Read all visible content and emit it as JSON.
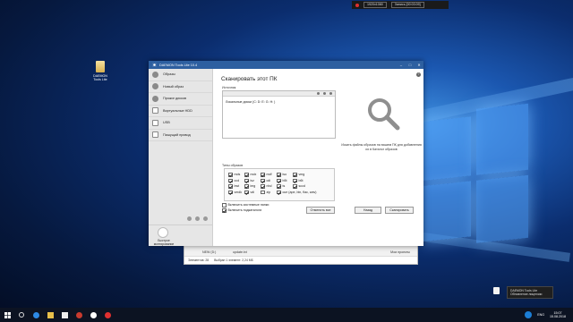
{
  "recorder": {
    "resolution": "1920x1080",
    "status": "Запись [00:03:09]"
  },
  "desktop_icon": {
    "label": "DAEMON Tools Lite"
  },
  "window": {
    "title": "DAEMON Tools Lite 10.4"
  },
  "sidebar": {
    "items": [
      {
        "label": "Образы",
        "icon": "disc-icon"
      },
      {
        "label": "Новый образ",
        "icon": "plus-disc-icon"
      },
      {
        "label": "Прожиг дисков",
        "icon": "burn-icon"
      },
      {
        "label": "Виртуальные HDD",
        "icon": "hdd-icon"
      },
      {
        "label": "USB",
        "icon": "usb-icon"
      },
      {
        "label": "Пишущий привод",
        "icon": "drive-icon"
      }
    ],
    "quick_mount_label": "Быстрое монтирование"
  },
  "main": {
    "title": "Сканировать этот ПК",
    "source_label": "Источник",
    "source_item": "Локальные диски (C: D: E: G: H: )",
    "hint": "Искать файлы образов на вашем ПК для добавления их в Каталог образов",
    "include_system_folders": "Включить системные папки",
    "include_subfolders": "Включить подкаталоги",
    "image_types_label": "Типы образов",
    "image_types": [
      {
        "label": "mds",
        "checked": true
      },
      {
        "label": "mdx",
        "checked": true
      },
      {
        "label": "mdf",
        "checked": true
      },
      {
        "label": "iso",
        "checked": true
      },
      {
        "label": "vmg",
        "checked": true
      },
      {
        "label": "ccd",
        "checked": true
      },
      {
        "label": "isz",
        "checked": true
      },
      {
        "label": "cdi",
        "checked": true
      },
      {
        "label": "b5t",
        "checked": true
      },
      {
        "label": "b6t",
        "checked": true
      },
      {
        "label": "bwt",
        "checked": true
      },
      {
        "label": "img",
        "checked": true
      },
      {
        "label": "nhd",
        "checked": true
      },
      {
        "label": "ts",
        "checked": true
      },
      {
        "label": "sccd",
        "checked": true
      },
      {
        "label": "vmdk",
        "checked": true
      },
      {
        "label": "vdi",
        "checked": true
      },
      {
        "label": "zip",
        "checked": false
      },
      {
        "label": "cue (ape, bin, flac, wav)",
        "checked": true
      }
    ],
    "buttons": {
      "cancel_all": "Отменить все",
      "back": "Назад",
      "scan": "Сканировать"
    }
  },
  "explorer": {
    "row1_name": "NEW (D:)",
    "row1_extra": "Мои проекты",
    "row2_name": "update.txt",
    "items_count": "Элементов: 28",
    "selected": "Выбран 1 элемент: 2,24 МБ"
  },
  "toast": {
    "line1": "DAEMON Tools Lite",
    "line2": "Обновление лицензии"
  },
  "tray": {
    "lang": "ENG",
    "time": "15:07",
    "date": "15.08.2018"
  },
  "colors": {
    "titlebar": "#2d5fa0",
    "taskbar": "#0c1322"
  }
}
